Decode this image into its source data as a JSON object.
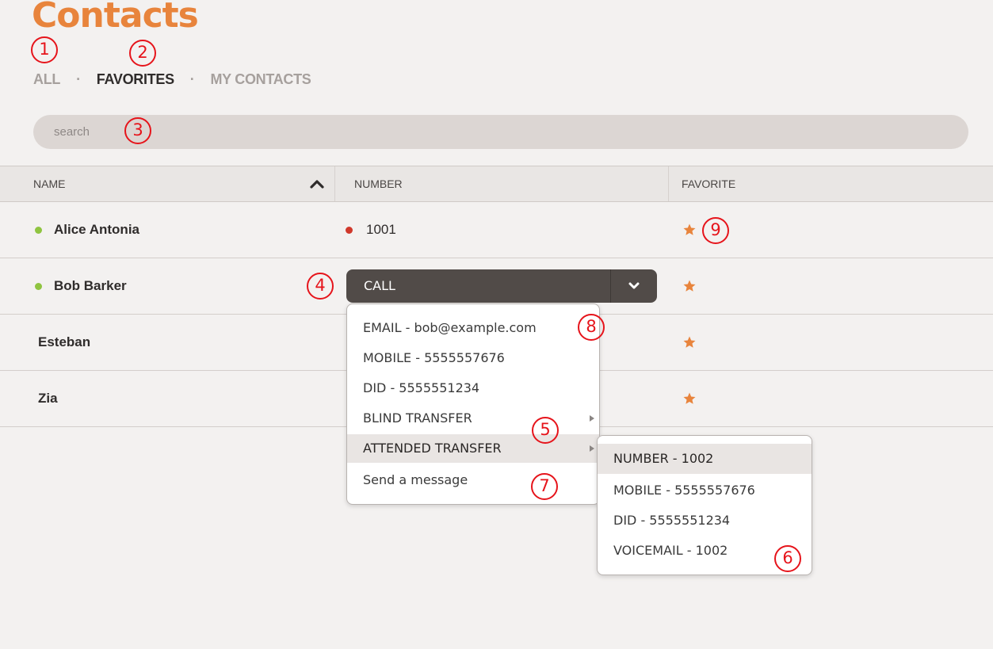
{
  "page": {
    "title": "Contacts"
  },
  "filters": {
    "all": "ALL",
    "favorites": "FAVORITES",
    "my_contacts": "MY CONTACTS",
    "separator": "·"
  },
  "search": {
    "placeholder": "search"
  },
  "table": {
    "headers": {
      "name": "NAME",
      "number": "NUMBER",
      "favorite": "FAVORITE"
    },
    "rows": [
      {
        "name": "Alice Antonia",
        "number": "1001",
        "favorite": true,
        "presence": "online",
        "number_status": "busy"
      },
      {
        "name": "Bob Barker",
        "number": "",
        "favorite": true,
        "presence": "online"
      },
      {
        "name": "Esteban",
        "number": "",
        "favorite": true,
        "presence": "none"
      },
      {
        "name": "Zia",
        "number": "",
        "favorite": true,
        "presence": "none"
      }
    ]
  },
  "call_button": {
    "label": "CALL"
  },
  "dropdown_menu": {
    "items": [
      "EMAIL - bob@example.com",
      "MOBILE - 5555557676",
      "DID - 5555551234",
      "BLIND TRANSFER",
      "ATTENDED TRANSFER",
      "Send a message"
    ]
  },
  "submenu": {
    "items": [
      "NUMBER - 1002",
      "MOBILE - 5555557676",
      "DID - 5555551234",
      "VOICEMAIL - 1002"
    ]
  },
  "annotations": [
    "1",
    "2",
    "3",
    "4",
    "5",
    "6",
    "7",
    "8",
    "9"
  ],
  "colors": {
    "accent": "#e8843c",
    "online": "#8fc440",
    "busy": "#d0382b",
    "annotation": "#e6141b",
    "call_button": "#514b48"
  },
  "icons": [
    "sort-up-icon",
    "chevron-down-icon",
    "star-icon",
    "submenu-arrow-icon"
  ]
}
